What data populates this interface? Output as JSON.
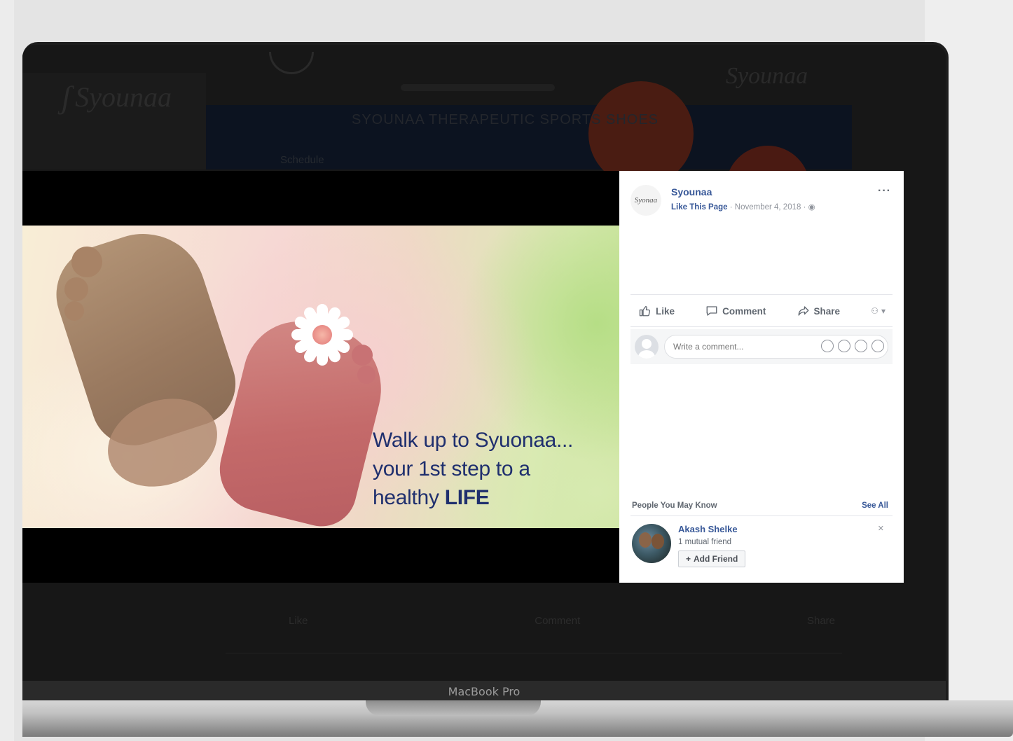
{
  "background_page": {
    "logo_text": "Syounaa",
    "right_logo_text": "Syounaa",
    "banner_title": "SYOUNAA THERAPEUTIC SPORTS SHOES",
    "banner_sub": "Schedule",
    "bottom_actions": [
      "Like",
      "Comment",
      "Share"
    ]
  },
  "photo": {
    "caption_line1": "Walk up to Syuonaa...",
    "caption_line2": "your 1st step to a",
    "caption_line3_prefix": "healthy ",
    "caption_line3_strong": "LIFE"
  },
  "post": {
    "avatar_text": "Syonaa",
    "page_name": "Syounaa",
    "like_page_label": "Like This Page",
    "meta_separator": " · ",
    "date": "November 4, 2018",
    "privacy_icon": "globe-icon",
    "more_label": "···"
  },
  "actions": {
    "like_label": "Like",
    "comment_label": "Comment",
    "share_label": "Share",
    "audience_icon": "people-icon"
  },
  "comment_box": {
    "placeholder": "Write a comment...",
    "icons": [
      "emoji-icon",
      "camera-icon",
      "gif-icon",
      "sticker-icon"
    ]
  },
  "people_you_may_know": {
    "title": "People You May Know",
    "see_all_label": "See All",
    "items": [
      {
        "name": "Akash Shelke",
        "mutual": "1 mutual friend",
        "button_label": "Add Friend"
      }
    ]
  },
  "device": {
    "label": "MacBook Pro"
  },
  "colors": {
    "fb_link": "#385898",
    "caption": "#1f2f6e",
    "screen_bg": "#111111"
  }
}
